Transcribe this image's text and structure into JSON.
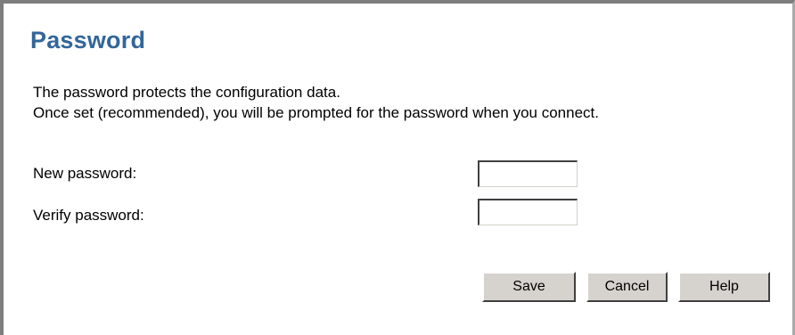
{
  "page": {
    "title": "Password",
    "description_lines": [
      "The password protects the configuration data.",
      "Once set (recommended), you will be prompted for the password when you connect."
    ]
  },
  "form": {
    "new_password": {
      "label": "New password:",
      "value": ""
    },
    "verify_password": {
      "label": "Verify password:",
      "value": ""
    }
  },
  "buttons": {
    "save": "Save",
    "cancel": "Cancel",
    "help": "Help"
  },
  "colors": {
    "title": "#336699",
    "button_face": "#d6d3ce",
    "frame_border": "#7d7d7d"
  }
}
